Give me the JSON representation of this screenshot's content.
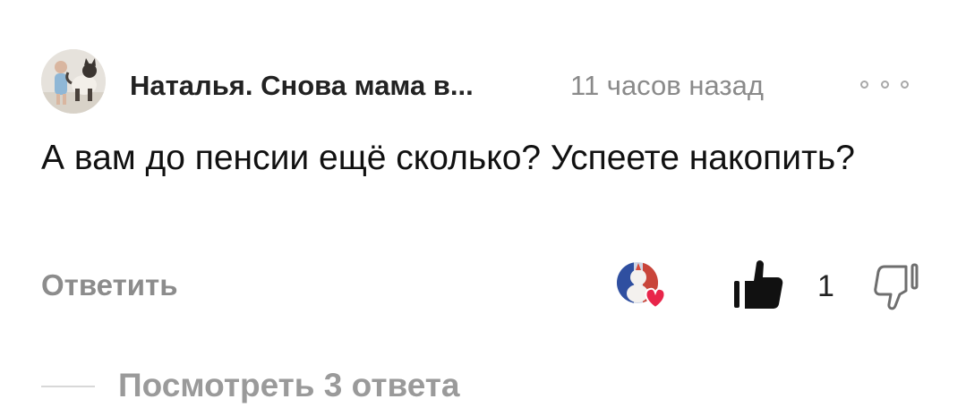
{
  "comment": {
    "author": "Наталья. Снова мама в...",
    "time": "11 часов назад",
    "text": "А вам до пенсии ещё сколько? Успеете накопить?",
    "reply_label": "Ответить",
    "like_count": "1",
    "view_replies_label": "Посмотреть 3 ответа"
  },
  "icons": {
    "avatar": "user-avatar",
    "more": "more-options-icon",
    "author_like": "author-heart-avatar",
    "like": "thumbs-up-icon",
    "dislike": "thumbs-down-icon"
  },
  "colors": {
    "heart": "#e8254a",
    "muted_text": "#8c8c8c",
    "like_filled": "#111111"
  }
}
